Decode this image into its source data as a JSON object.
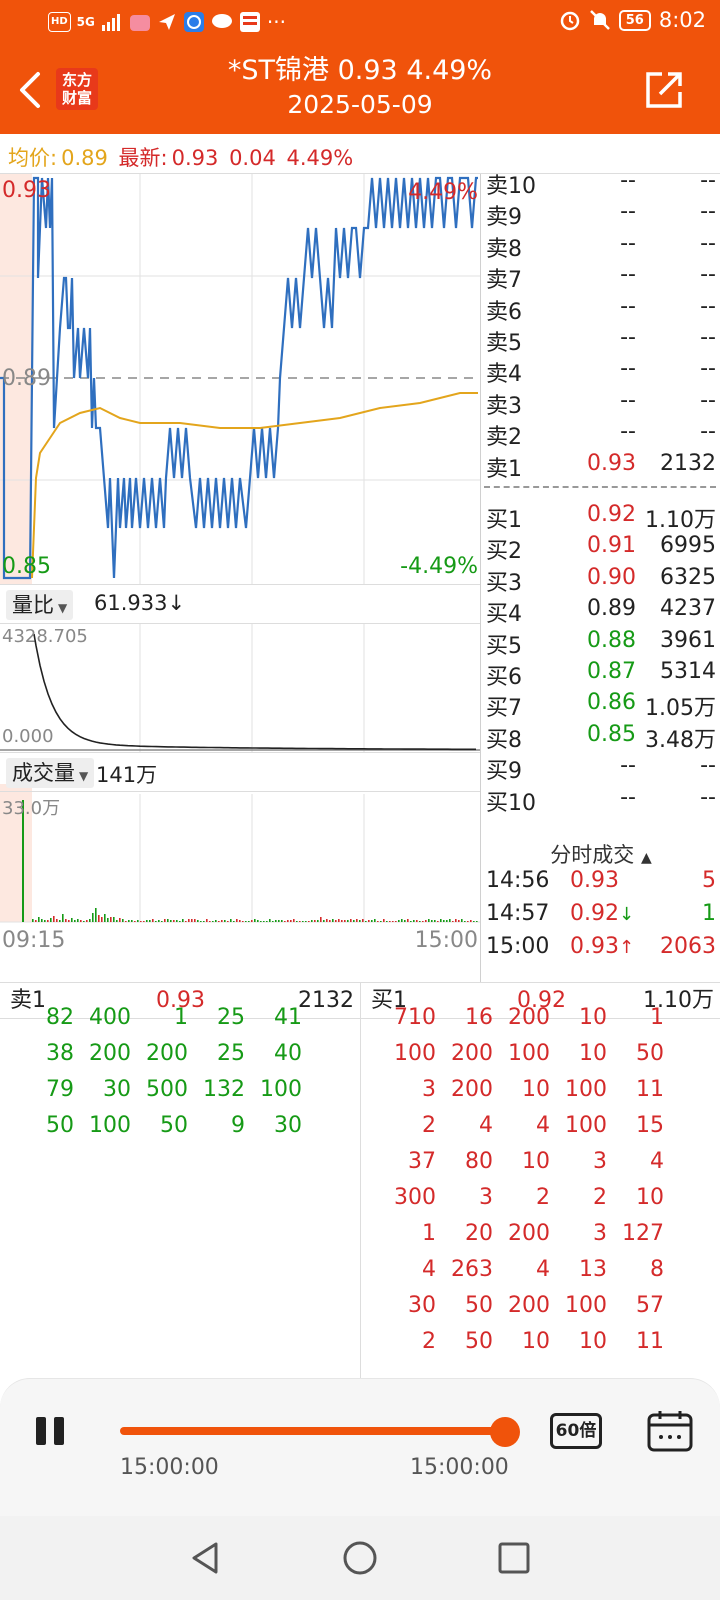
{
  "status": {
    "hd": "HD",
    "net": "5G",
    "time": "8:02",
    "battery": "56",
    "more": "···"
  },
  "header": {
    "title": "*ST锦港  0.93  4.49%",
    "date": "2025-05-09",
    "logo_line1": "东方",
    "logo_line2": "财富"
  },
  "info": {
    "avg_label": "均价:",
    "avg": "0.89",
    "latest_label": "最新:",
    "latest": "0.93",
    "change": "0.04",
    "change_pct": "4.49%"
  },
  "price_chart": {
    "high": "0.93",
    "mid": "0.89",
    "low": "0.85",
    "up_pct": "4.49%",
    "down_pct": "-4.49%"
  },
  "ratio_panel": {
    "label": "量比",
    "value": "61.933↓",
    "top": "4328.705",
    "bottom": "0.000"
  },
  "volume_panel": {
    "label": "成交量",
    "value": "141万",
    "top": "33.0万",
    "start_time": "09:15",
    "end_time": "15:00"
  },
  "sell_levels": [
    {
      "label": "卖10",
      "price": "--",
      "vol": "--"
    },
    {
      "label": "卖9",
      "price": "--",
      "vol": "--"
    },
    {
      "label": "卖8",
      "price": "--",
      "vol": "--"
    },
    {
      "label": "卖7",
      "price": "--",
      "vol": "--"
    },
    {
      "label": "卖6",
      "price": "--",
      "vol": "--"
    },
    {
      "label": "卖5",
      "price": "--",
      "vol": "--"
    },
    {
      "label": "卖4",
      "price": "--",
      "vol": "--"
    },
    {
      "label": "卖3",
      "price": "--",
      "vol": "--"
    },
    {
      "label": "卖2",
      "price": "--",
      "vol": "--"
    },
    {
      "label": "卖1",
      "price": "0.93",
      "vol": "2132"
    }
  ],
  "buy_levels": [
    {
      "label": "买1",
      "price": "0.92",
      "vol": "1.10万"
    },
    {
      "label": "买2",
      "price": "0.91",
      "vol": "6995"
    },
    {
      "label": "买3",
      "price": "0.90",
      "vol": "6325"
    },
    {
      "label": "买4",
      "price": "0.89",
      "vol": "4237"
    },
    {
      "label": "买5",
      "price": "0.88",
      "vol": "3961"
    },
    {
      "label": "买6",
      "price": "0.87",
      "vol": "5314"
    },
    {
      "label": "买7",
      "price": "0.86",
      "vol": "1.05万"
    },
    {
      "label": "买8",
      "price": "0.85",
      "vol": "3.48万"
    },
    {
      "label": "买9",
      "price": "--",
      "vol": "--"
    },
    {
      "label": "买10",
      "price": "--",
      "vol": "--"
    }
  ],
  "trades": {
    "title": "分时成交",
    "rows": [
      {
        "time": "14:56",
        "price": "0.93",
        "arrow": "",
        "vol": "5"
      },
      {
        "time": "14:57",
        "price": "0.92",
        "arrow": "↓",
        "vol": "1"
      },
      {
        "time": "15:00",
        "price": "0.93",
        "arrow": "↑",
        "vol": "2063"
      }
    ]
  },
  "queues": {
    "sell_label": "卖1",
    "sell_price": "0.93",
    "sell_vol": "2132",
    "buy_label": "买1",
    "buy_price": "0.92",
    "buy_vol": "1.10万",
    "sell_rows": [
      [
        "82",
        "400",
        "1",
        "25",
        "41"
      ],
      [
        "38",
        "200",
        "200",
        "25",
        "40"
      ],
      [
        "79",
        "30",
        "500",
        "132",
        "100"
      ],
      [
        "50",
        "100",
        "50",
        "9",
        "30"
      ]
    ],
    "buy_rows": [
      [
        "710",
        "16",
        "200",
        "10",
        "1"
      ],
      [
        "100",
        "200",
        "100",
        "10",
        "50"
      ],
      [
        "3",
        "200",
        "10",
        "100",
        "11"
      ],
      [
        "2",
        "4",
        "4",
        "100",
        "15"
      ],
      [
        "37",
        "80",
        "10",
        "3",
        "4"
      ],
      [
        "300",
        "3",
        "2",
        "2",
        "10"
      ],
      [
        "1",
        "20",
        "200",
        "3",
        "127"
      ],
      [
        "4",
        "263",
        "4",
        "13",
        "8"
      ],
      [
        "30",
        "50",
        "200",
        "100",
        "57"
      ],
      [
        "2",
        "50",
        "10",
        "10",
        "11"
      ]
    ]
  },
  "player": {
    "start": "15:00:00",
    "end": "15:00:00",
    "speed": "60倍",
    "progress": 1.0
  },
  "colors": {
    "orange": "#f0530b",
    "red": "#d42a2a",
    "green": "#169a16",
    "price_line": "#2f6fbf",
    "avg_line": "#e3a51c"
  }
}
